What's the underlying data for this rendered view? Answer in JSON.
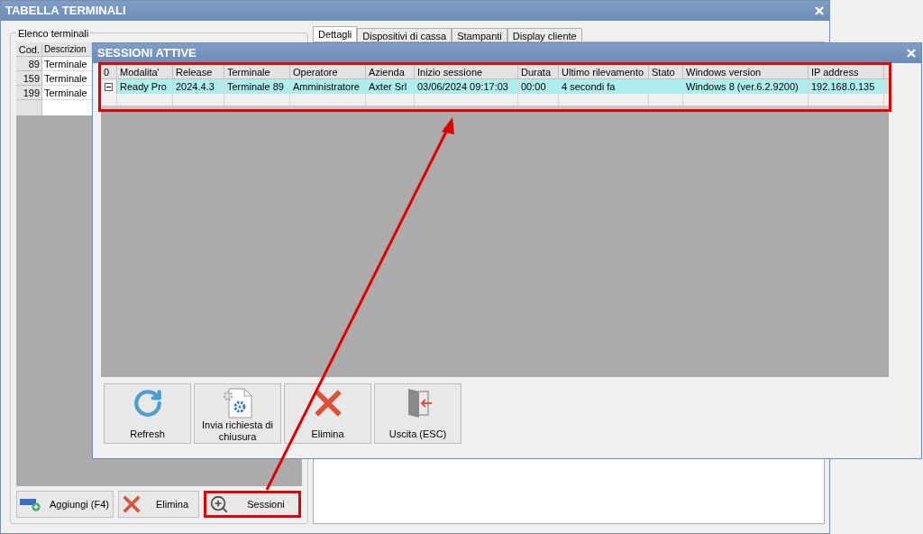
{
  "window": {
    "title": "TABELLA TERMINALI"
  },
  "terminals_group": {
    "title": "Elenco terminali",
    "columns": [
      "Cod.",
      "Descrizion"
    ],
    "rows": [
      {
        "code": "89",
        "description": "Terminale"
      },
      {
        "code": "159",
        "description": "Terminale"
      },
      {
        "code": "199",
        "description": "Terminale"
      }
    ],
    "buttons": [
      {
        "kind": "add",
        "label": "Aggiungi (F4)",
        "highlighted": false
      },
      {
        "kind": "delete",
        "label": "Elimina",
        "highlighted": false
      },
      {
        "kind": "sessions",
        "label": "Sessioni",
        "highlighted": true
      }
    ]
  },
  "tabs": [
    {
      "label": "Dettagli",
      "selected": true
    },
    {
      "label": "Dispositivi di cassa",
      "selected": false
    },
    {
      "label": "Stampanti",
      "selected": false
    },
    {
      "label": "Display cliente",
      "selected": false
    }
  ],
  "dialog": {
    "title": "SESSIONI ATTIVE",
    "grid": {
      "highlighted": true,
      "corner": "0",
      "columns": [
        "Modalita'",
        "Release",
        "Terminale",
        "Operatore",
        "Azienda",
        "Inizio sessione",
        "Durata",
        "Ultimo rilevamento",
        "Stato",
        "Windows version",
        "IP address"
      ],
      "rows": [
        {
          "selected": true,
          "cells": [
            "Ready Pro",
            "2024.4.3",
            "Terminale 89",
            "Amministratore",
            "Axter Srl",
            "03/06/2024 09:17:03",
            "00:00",
            "4 secondi fa",
            "",
            "Windows 8 (ver.6.2.9200)",
            "192.168.0.135"
          ]
        }
      ]
    },
    "buttons": [
      {
        "kind": "refresh",
        "label": "Refresh"
      },
      {
        "kind": "send",
        "label": "Invia richiesta di chiusura"
      },
      {
        "kind": "delete",
        "label": "Elimina"
      },
      {
        "kind": "exit",
        "label": "Uscita (ESC)"
      }
    ]
  }
}
